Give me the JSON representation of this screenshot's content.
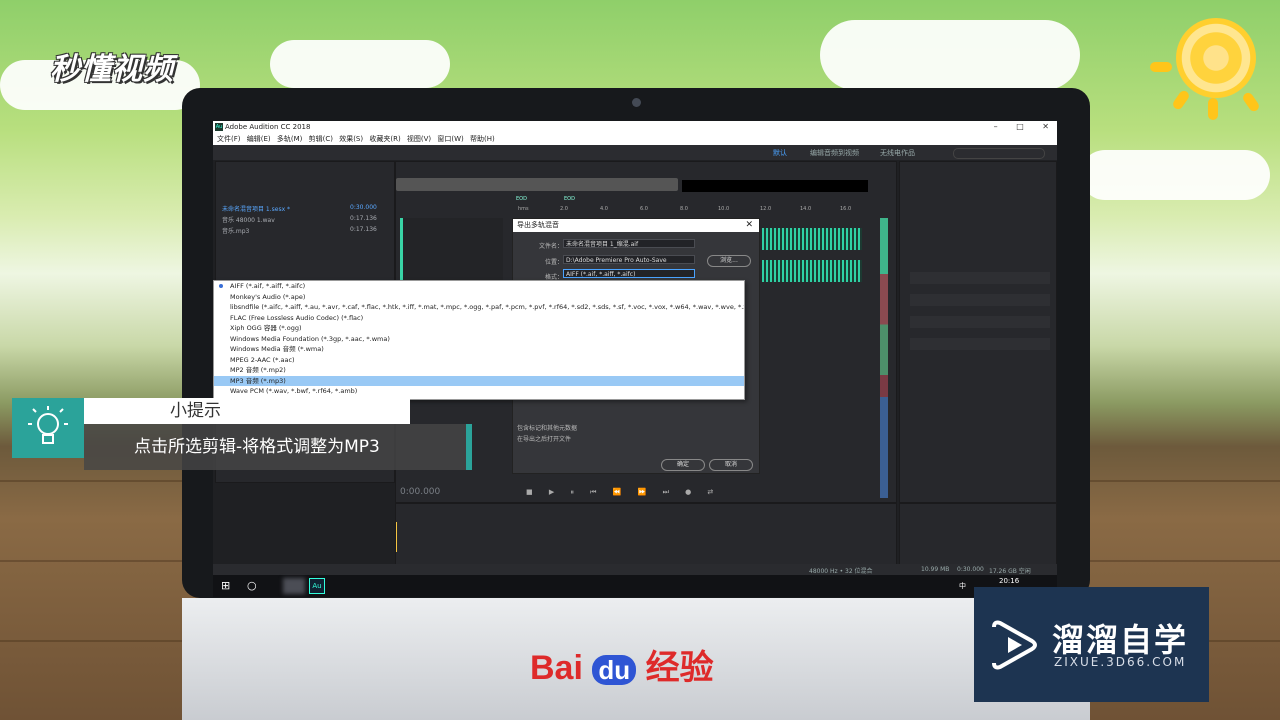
{
  "watermark_logo": "秒懂视频",
  "app": {
    "window_title": "Adobe Audition CC 2018",
    "window_controls": [
      "–",
      "□",
      "✕"
    ],
    "menu": [
      "文件(F)",
      "编辑(E)",
      "多轨(M)",
      "剪辑(C)",
      "效果(S)",
      "收藏夹(R)",
      "视图(V)",
      "窗口(W)",
      "帮助(H)"
    ],
    "workspaces": [
      "默认",
      "编辑音频到视频",
      "无线电作品"
    ],
    "files": [
      {
        "name": "未命名混音项目 1.sesx *",
        "duration": "0:30.000"
      },
      {
        "name": "音乐 48000 1.wav",
        "duration": "0:17.136"
      },
      {
        "name": "音乐.mp3",
        "duration": "0:17.136"
      }
    ],
    "timecode": "0:00.000",
    "ruler_ticks": [
      "hms",
      "2.0",
      "4.0",
      "6.0",
      "8.0",
      "10.0",
      "12.0",
      "14.0",
      "16.0"
    ],
    "eod_markers": [
      "EOD",
      "EOD"
    ],
    "status": {
      "sample": "48000 Hz • 32 位混合",
      "size": "10.99 MB",
      "duration": "0:30.000",
      "free": "17.26 GB 空闲"
    },
    "clock": "20:16",
    "tray": "中"
  },
  "dialog": {
    "title": "导出多轨混音",
    "filename_label": "文件名：",
    "filename_value": "未命名混音项目 1_缩混.aif",
    "location_label": "位置：",
    "location_value": "D:\\Adobe Premiere Pro Auto-Save",
    "browse_label": "浏览...",
    "format_label": "格式：",
    "format_value": "AIFF (*.aif, *.aiff, *.aifc)",
    "checkbox1": "包含标记和其他元数据",
    "checkbox2": "在导出之后打开文件",
    "ok_label": "确定",
    "cancel_label": "取消"
  },
  "format_options": [
    "AIFF (*.aif, *.aiff, *.aifc)",
    "Monkey's Audio (*.ape)",
    "libsndfile (*.aifc, *.aiff, *.au, *.avr, *.caf, *.flac, *.htk, *.iff, *.mat, *.mpc, *.ogg, *.paf, *.pcm, *.pvf, *.rf64, *.sd2, *.sds, *.sf, *.voc, *.vox, *.w64, *.wav, *.wve, *.xi)",
    "FLAC (Free Lossless Audio Codec) (*.flac)",
    "Xiph OGG 容器 (*.ogg)",
    "Windows Media Foundation (*.3gp, *.aac, *.wma)",
    "Windows Media 音频 (*.wma)",
    "MPEG 2-AAC (*.aac)",
    "MP2 音频 (*.mp2)",
    "MP3 音频 (*.mp3)",
    "Wave PCM (*.wav, *.bwf, *.rf64, *.amb)"
  ],
  "tip": {
    "heading": "小提示",
    "body": "点击所选剪辑-将格式调整为MP3"
  },
  "zixue": {
    "title": "溜溜自学",
    "url": "ZIXUE.3D66.COM"
  },
  "baidu": {
    "bai": "Bai",
    "du": "du",
    "jy": "经验"
  }
}
